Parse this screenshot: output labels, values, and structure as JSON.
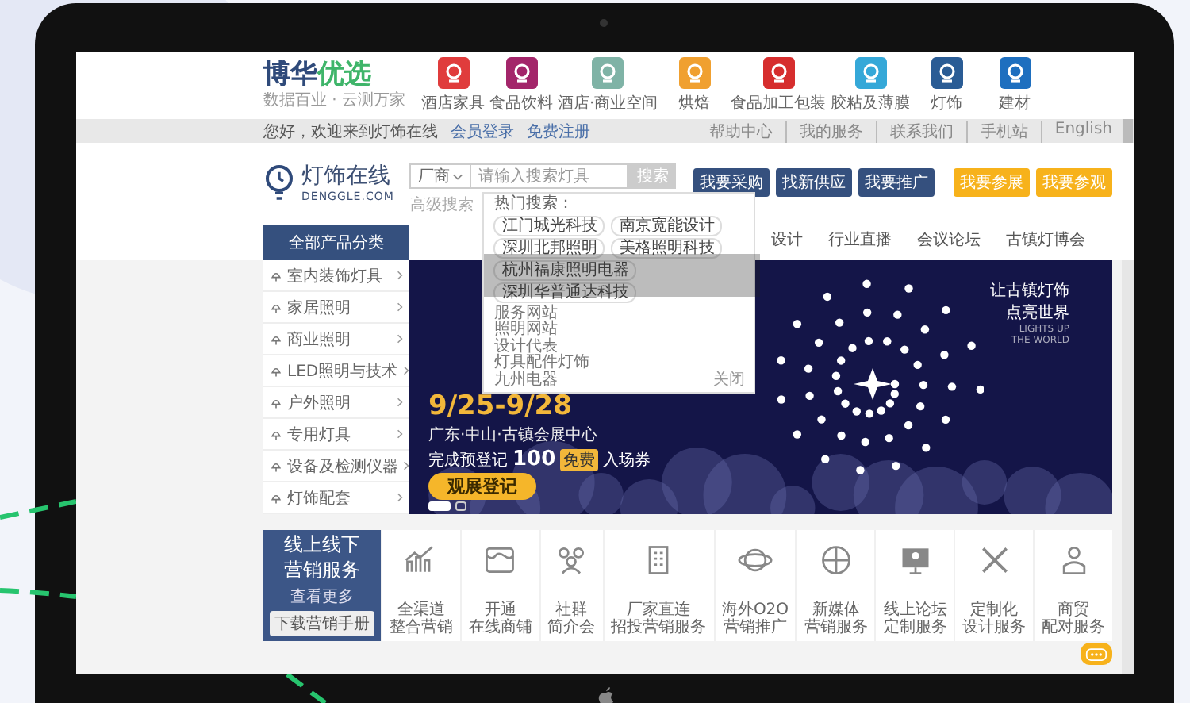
{
  "header": {
    "logo": [
      "博华",
      "优选"
    ],
    "tagline": "数据百业 · 云测万家",
    "categories": [
      {
        "label": "酒店家具",
        "color": "#e03c3c"
      },
      {
        "label": "食品饮料",
        "color": "#a3256a"
      },
      {
        "label": "酒店·商业空间",
        "color": "#7fb3a6"
      },
      {
        "label": "烘焙",
        "color": "#f0a030"
      },
      {
        "label": "食品加工包装",
        "color": "#d62e2e"
      },
      {
        "label": "胶粘及薄膜",
        "color": "#35a8d8"
      },
      {
        "label": "灯饰",
        "color": "#2a5c95"
      },
      {
        "label": "建材",
        "color": "#1e6fbf"
      }
    ]
  },
  "top_bar": {
    "greeting": "您好，欢迎来到灯饰在线",
    "links_left": [
      "会员登录",
      "免费注册"
    ],
    "links_right": [
      "帮助中心",
      "我的服务",
      "联系我们",
      "手机站",
      "English"
    ]
  },
  "site": {
    "name": "灯饰在线",
    "domain": "DENGGLE.COM"
  },
  "search": {
    "scope": "厂商",
    "placeholder": "请输入搜索灯具",
    "button": "搜索",
    "advanced": "高级搜索",
    "dropdown": {
      "heading": "热门搜索：",
      "tags": [
        "江门城光科技",
        "南京宽能设计",
        "深圳北邦照明",
        "美格照明科技",
        "杭州福康照明电器",
        "深圳华普通达科技"
      ],
      "items": [
        "服务网站",
        "照明网站",
        "设计代表",
        "灯具配件灯饰",
        "九州电器"
      ],
      "close": "关闭"
    }
  },
  "action_buttons": [
    {
      "label": "我要采购",
      "kind": "primary"
    },
    {
      "label": "找新供应",
      "kind": "primary"
    },
    {
      "label": "我要推广",
      "kind": "primary"
    },
    {
      "label": "我要参展",
      "kind": "highlight"
    },
    {
      "label": "我要参观",
      "kind": "highlight"
    }
  ],
  "category_menu": {
    "title": "全部产品分类",
    "items": [
      "室内装饰灯具",
      "家居照明",
      "商业照明",
      "LED照明与技术",
      "户外照明",
      "专用灯具",
      "设备及检测仪器",
      "灯饰配套"
    ]
  },
  "nav": [
    "设计",
    "行业直播",
    "会议论坛",
    "古镇灯博会"
  ],
  "banner": {
    "dates": "9/25-9/28",
    "venue": "广东·中山·古镇会展中心",
    "offer": "完成预登记",
    "amount": "100",
    "badge": "免费",
    "badge_note": "入场券",
    "cta": "观展登记",
    "slogan": [
      "让古镇灯饰",
      "点亮世界"
    ],
    "slogan_en": "LIGHTS UP\nTHE WORLD",
    "slides": [
      {
        "selected": true
      },
      {
        "selected": false
      }
    ]
  },
  "services": {
    "title": [
      "线上线下",
      "营销服务"
    ],
    "more": "查看更多",
    "download": "下载营销手册",
    "items": [
      [
        "全渠道",
        "整合营销"
      ],
      [
        "开通",
        "在线商铺"
      ],
      [
        "社群",
        "简介会"
      ],
      [
        "厂家直连",
        "招投营销服务"
      ],
      [
        "海外O2O",
        "营销推广"
      ],
      [
        "新媒体",
        "营销服务"
      ],
      [
        "线上论坛",
        "定制服务"
      ],
      [
        "定制化",
        "设计服务"
      ],
      [
        "商贸",
        "配对服务"
      ]
    ]
  }
}
